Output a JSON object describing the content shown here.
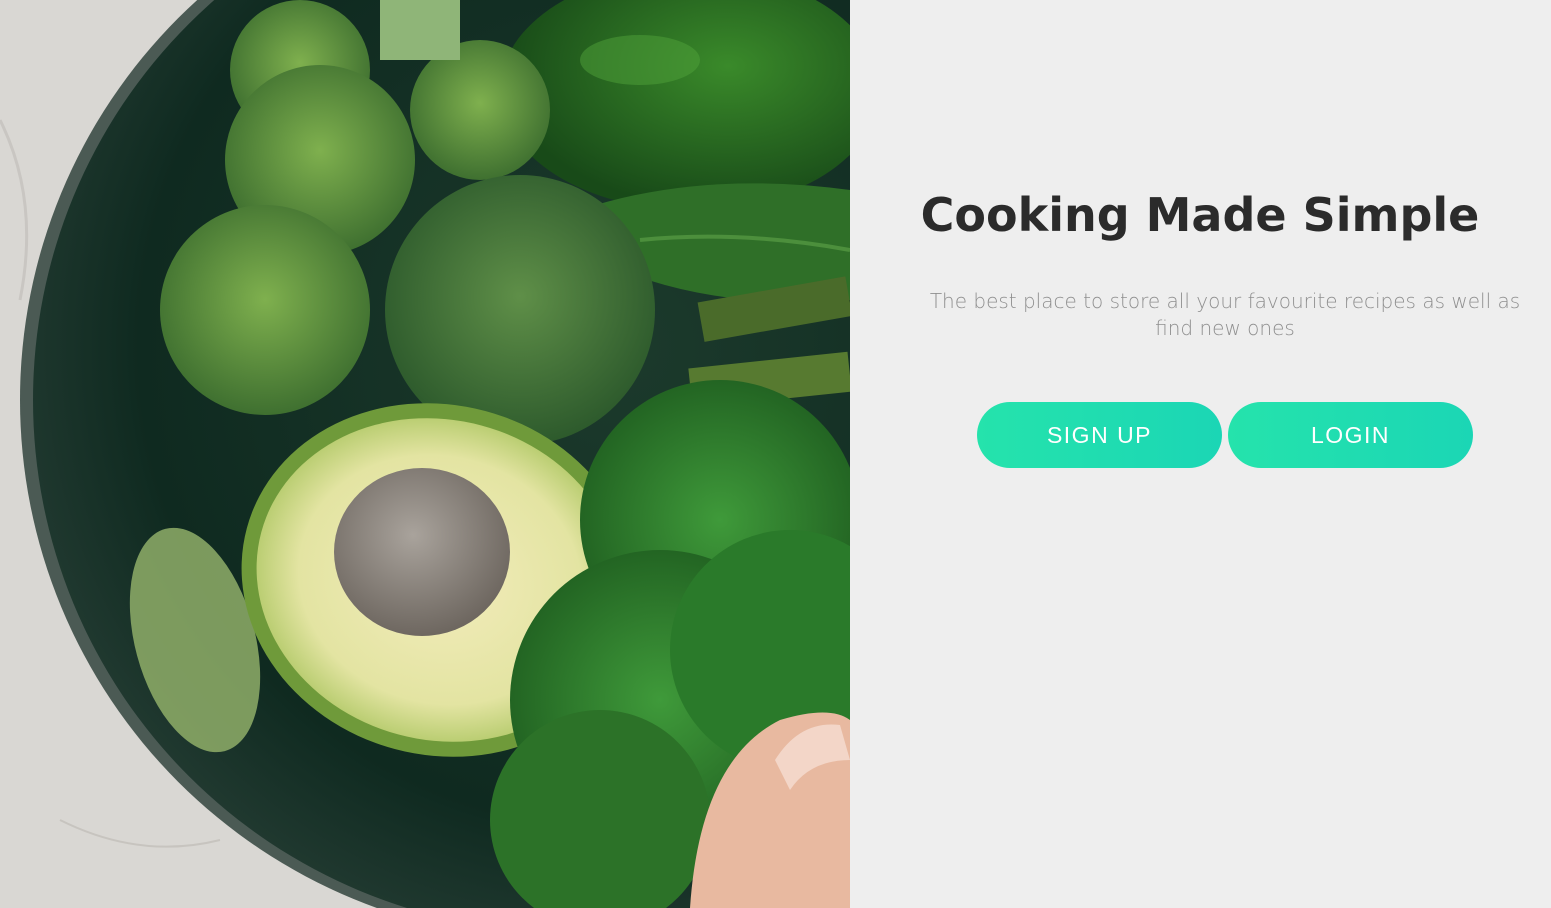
{
  "hero": {
    "image": "green-vegetables-in-bowl"
  },
  "content": {
    "title": "Cooking Made Simple",
    "tagline": "The best place to store all your favourite recipes as well as find new ones",
    "signup_label": "SIGN UP",
    "login_label": "LOGIN"
  },
  "colors": {
    "background": "#eeeeee",
    "title": "#2b2b2b",
    "tagline": "#8f8f8f",
    "button_gradient_start": "#25e3ac",
    "button_gradient_end": "#1bd6b5",
    "button_text": "#ffffff"
  }
}
